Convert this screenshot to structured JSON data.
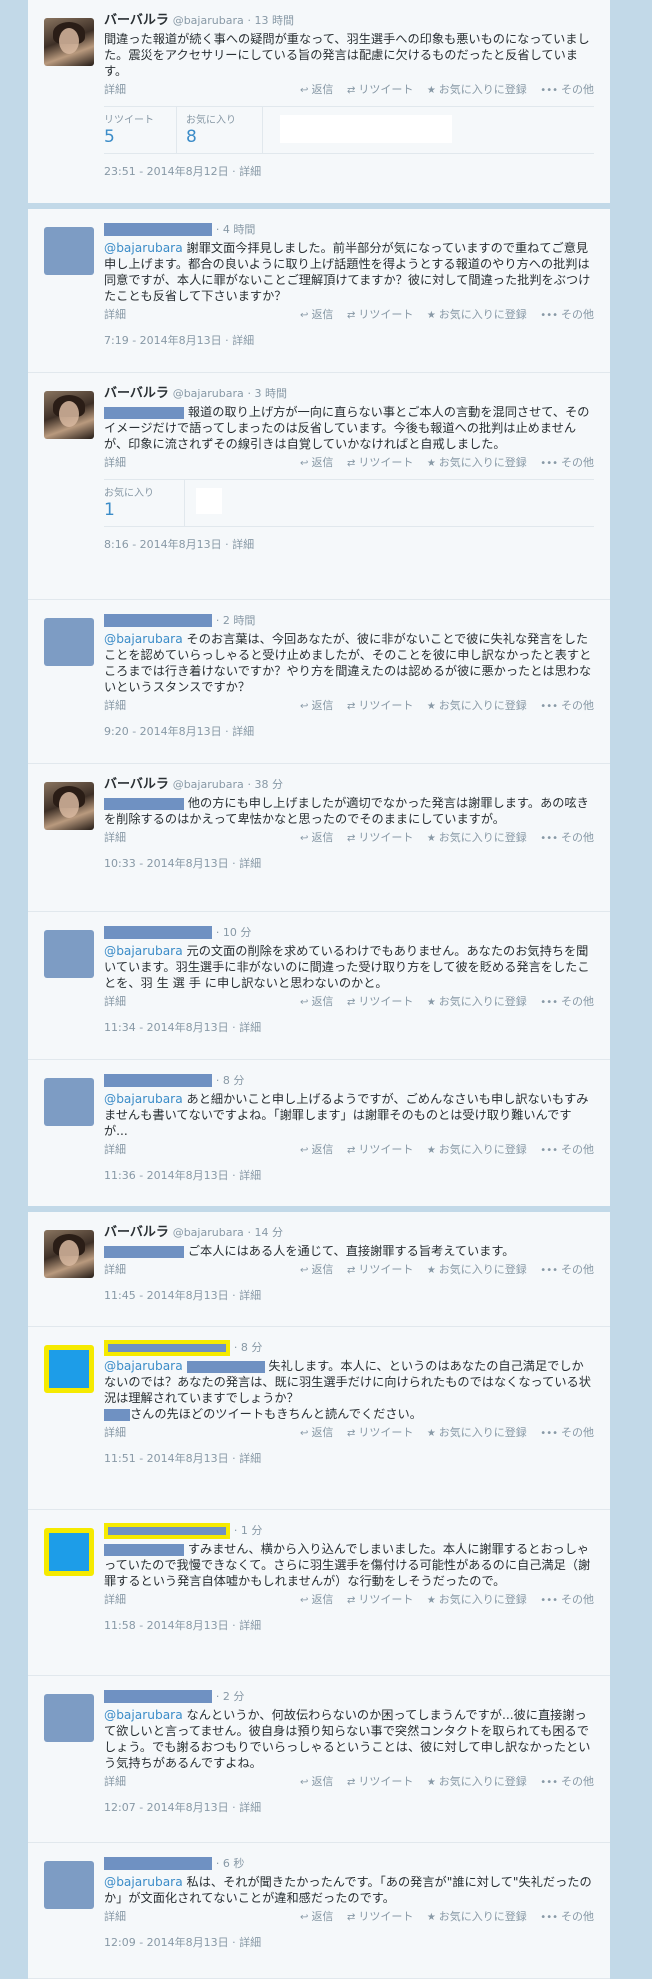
{
  "user": {
    "name": "バーバルラ",
    "handle": "@bajarubara"
  },
  "actions": {
    "detail": "詳細",
    "reply": "返信",
    "retweet": "リツイート",
    "favorite": "お気に入りに登録",
    "more": "その他"
  },
  "tweets": [
    {
      "time": "· 13 時間",
      "text": "間違った報道が続く事への疑問が重なって、羽生選手への印象も悪いものになっていました。震災をアクセサリーにしている旨の発言は配慮に欠けるものだったと反省しています。",
      "stats": {
        "rt_label": "リツイート",
        "rt_count": "5",
        "fav_label": "お気に入り",
        "fav_count": "8"
      },
      "footer": "23:51 - 2014年8月12日 · 詳細"
    },
    {
      "time": "· 4 時間",
      "mention": "@bajarubara",
      "text": " 謝罪文面今拝見しました。前半部分が気になっていますので重ねてご意見申し上げます。都合の良いように取り上げ話題性を得ようとする報道のやり方への批判は同意ですが、本人に罪がないことご理解頂けてますか？彼に対して間違った批判をぶつけたことも反省して下さいますか？",
      "footer": "7:19 - 2014年8月13日 · 詳細"
    },
    {
      "time": "· 3 時間",
      "text": " 報道の取り上げ方が一向に直らない事とご本人の言動を混同させて、そのイメージだけで語ってしまったのは反省しています。今後も報道への批判は止めませんが、印象に流されずその線引きは自覚していかなければと自戒しました。",
      "stats": {
        "fav_label": "お気に入り",
        "fav_count": "1"
      },
      "footer": "8:16 - 2014年8月13日 · 詳細"
    },
    {
      "time": "· 2 時間",
      "mention": "@bajarubara",
      "text": " そのお言葉は、今回あなたが、彼に非がないことで彼に失礼な発言をしたことを認めていらっしゃると受け止めましたが、そのことを彼に申し訳なかったと表すところまでは行き着けないですか？やり方を間違えたのは認めるが彼に悪かったとは思わないというスタンスですか？",
      "footer": "9:20 - 2014年8月13日 · 詳細"
    },
    {
      "time": "· 38 分",
      "text": " 他の方にも申し上げましたが適切でなかった発言は謝罪します。あの呟きを削除するのはかえって卑怯かなと思ったのでそのままにしていますが。",
      "footer": "10:33 - 2014年8月13日 · 詳細"
    },
    {
      "time": "· 10 分",
      "mention": "@bajarubara",
      "text": " 元の文面の削除を求めているわけでもありません。あなたのお気持ちを聞いています。羽生選手に非がないのに間違った受け取り方をして彼を貶める発言をしたことを、羽 生 選 手 に申し訳ないと思わないのかと。",
      "footer": "11:34 - 2014年8月13日 · 詳細"
    },
    {
      "time": "· 8 分",
      "mention": "@bajarubara",
      "text": " あと細かいこと申し上げるようですが、ごめんなさいも申し訳ないもすみませんも書いてないですよね。「謝罪します」は謝罪そのものとは受け取り難いんですが...",
      "footer": "11:36 - 2014年8月13日 · 詳細"
    },
    {
      "time": "· 14 分",
      "text": " ご本人にはある人を通じて、直接謝罪する旨考えています。",
      "footer": "11:45 - 2014年8月13日 · 詳細"
    },
    {
      "time": "· 8 分",
      "mention": "@bajarubara",
      "text": " 失礼します。本人に、というのはあなたの自己満足でしかないのでは？あなたの発言は、既に羽生選手だけに向けられたものではなくなっている状況は理解されていますでしょうか？",
      "text2": "さんの先ほどのツイートもきちんと読んでください。",
      "footer": "11:51 - 2014年8月13日 · 詳細"
    },
    {
      "time": "· 1 分",
      "text": " すみません、横から入り込んでしまいました。本人に謝罪するとおっしゃっていたので我慢できなくて。さらに羽生選手を傷付ける可能性があるのに自己満足（謝罪するという発言自体嘘かもしれませんが）な行動をしそうだったので。",
      "footer": "11:58 - 2014年8月13日 · 詳細"
    },
    {
      "time": "· 2 分",
      "mention": "@bajarubara",
      "text": " なんというか、何故伝わらないのか困ってしまうんですが...彼に直接謝って欲しいと言ってません。彼自身は預り知らない事で突然コンタクトを取られても困るでしょう。でも謝るおつもりでいらっしゃるということは、彼に対して申し訳なかったという気持ちがあるんですよね。",
      "footer": "12:07 - 2014年8月13日 · 詳細"
    },
    {
      "time": "· 6 秒",
      "mention": "@bajarubara",
      "text": " 私は、それが聞きたかったんです。「あの発言が\"誰に対して\"失礼だったのか」が文面化されてないことが違和感だったのです。",
      "footer": "12:09 - 2014年8月13日 · 詳細"
    }
  ]
}
